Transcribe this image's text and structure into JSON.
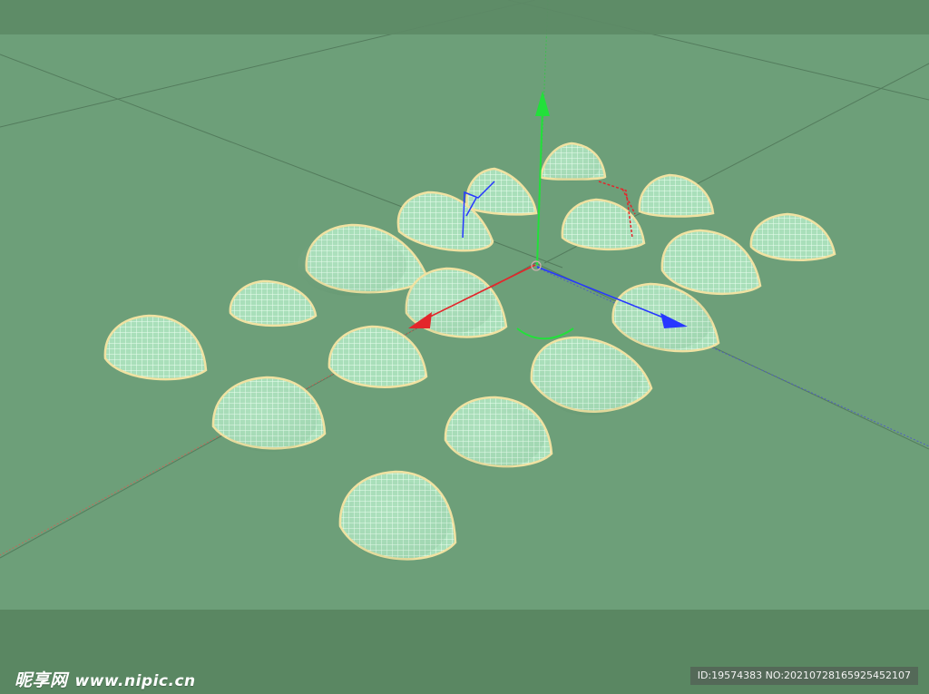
{
  "viewport": {
    "background_color": "#6d9f79",
    "band_color": "#5d8a66",
    "grid_color": "#3f5f46",
    "mesh_fill_color": "#b9ecc9",
    "mesh_outline_color": "#f0e2a2"
  },
  "gizmo": {
    "x_axis_color": "#e3262b",
    "y_axis_color": "#22e03a",
    "z_axis_color": "#2737ff"
  },
  "watermark": {
    "brand": "昵享网",
    "url": "www.nipic.cn",
    "id_text": "ID:19574383 NO:20210728165925452107"
  }
}
